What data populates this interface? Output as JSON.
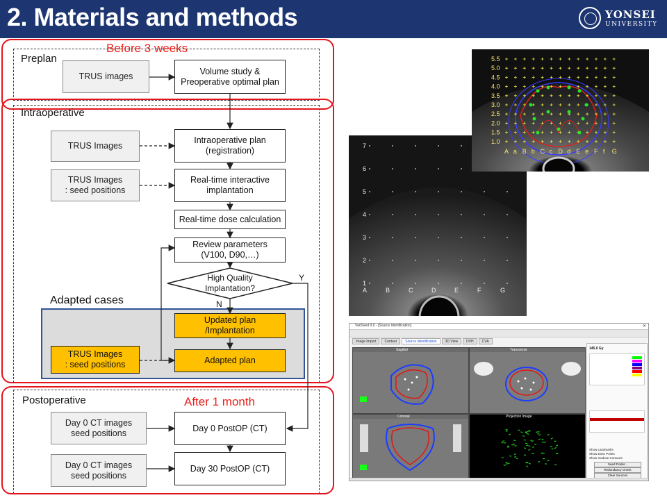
{
  "slide": {
    "title": "2. Materials and methods"
  },
  "logo": {
    "name": "YONSEI",
    "sub": "UNIVERSITY",
    "icon": "university-seal-icon"
  },
  "sections": {
    "preplan": "Preplan",
    "intraoperative": "Intraoperative",
    "adapted": "Adapted cases",
    "postoperative": "Postoperative"
  },
  "annotations": {
    "before": "Before 3 weeks",
    "after": "After 1 month"
  },
  "boxes": {
    "pre_trus": "TRUS  images",
    "pre_volume": "Volume study &\nPreoperative optimal plan",
    "intra_trus1": "TRUS  Images",
    "intra_trus2": "TRUS Images\n: seed positions",
    "intra_plan": "Intraoperative plan\n(registration)",
    "realtime_impl": "Real-time interactive\nimplantation",
    "dose_calc": "Real-time dose calculation",
    "review": "Review parameters\n(V100, D90,…)",
    "decision": "High Quality\nImplantation?",
    "updated": "Updated plan\n/Implantation",
    "adapted_plan": "Adapted plan",
    "adapted_trus": "TRUS Images\n: seed positions",
    "post_ct1": "Day 0 CT images\nseed positions",
    "post_day0": "Day 0 PostOP (CT)",
    "post_ct2": "Day 0 CT images\nseed positions",
    "post_day30": "Day 30 PostOP (CT)"
  },
  "decision_labels": {
    "yes": "Y",
    "no": "N"
  },
  "figures": {
    "trus_grid": {
      "rows": [
        "5.5",
        "5.0",
        "4.5",
        "4.0",
        "3.5",
        "3.0",
        "2.5",
        "2.0",
        "1.5",
        "1.0"
      ],
      "cols": [
        "A",
        "a",
        "B",
        "b",
        "C",
        "c",
        "D",
        "d",
        "E",
        "e",
        "F",
        "f",
        "G"
      ]
    },
    "trus_plain": {
      "rows": [
        "7",
        "6",
        "5",
        "4",
        "3",
        "2",
        "1"
      ],
      "cols": [
        "A",
        "B",
        "C",
        "D",
        "E",
        "F",
        "G"
      ]
    },
    "software": {
      "title": "VariSeed 9.0 - [Source Identification]",
      "tabs": [
        "Image Import",
        "Contour",
        "Source Identification",
        "3D View",
        "DVH",
        "CVA"
      ],
      "views": [
        "Sagittal",
        "Transverse",
        "Coronal",
        "Projection Image"
      ],
      "prescription": "145.0 Gy",
      "buttons": [
        "Seed Finder...",
        "Redundancy Check",
        "Clear Sources"
      ],
      "checks": [
        "Show Landmarks",
        "Show Dose Points",
        "Show Isodose Contours"
      ]
    }
  }
}
